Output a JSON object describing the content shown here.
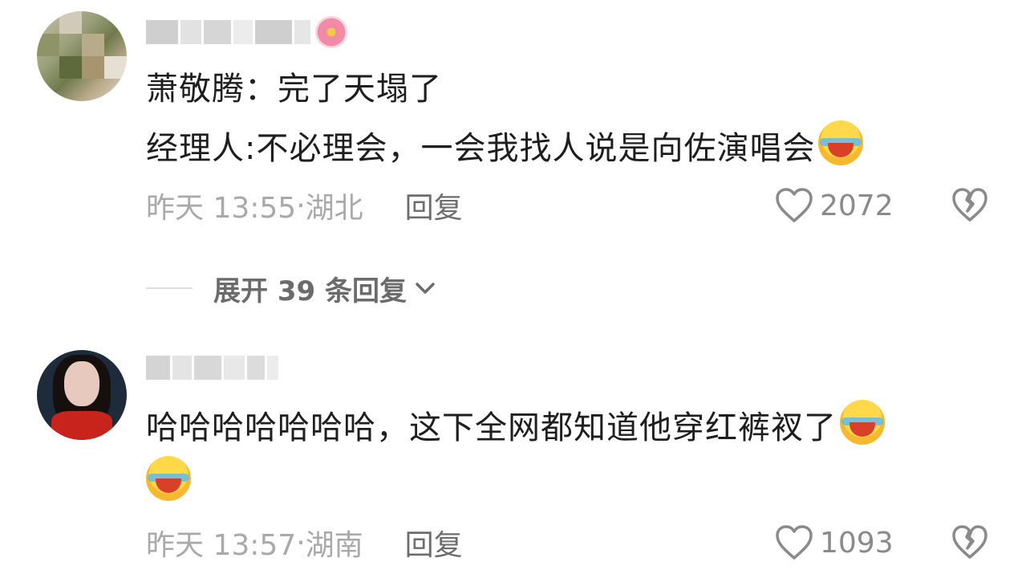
{
  "comments": [
    {
      "text_lines": [
        "萧敬腾：完了天塌了",
        "经理人:不必理会，一会我找人说是向佐演唱会"
      ],
      "emoji": "laughing-crying-emoji",
      "time": "昨天 13:55",
      "location": "湖北",
      "reply_label": "回复",
      "likes": "2072"
    },
    {
      "text_lines": [
        "哈哈哈哈哈哈哈，这下全网都知道他穿红裤衩了"
      ],
      "emoji": "laughing-crying-emoji",
      "time": "昨天 13:57",
      "location": "湖南",
      "reply_label": "回复",
      "likes": "1093"
    }
  ],
  "expand_replies": {
    "label": "展开 39 条回复"
  },
  "colors": {
    "meta_gray": "#a9a9a9",
    "text": "#1e1e1e",
    "icon_gray": "#8a8a8a"
  }
}
